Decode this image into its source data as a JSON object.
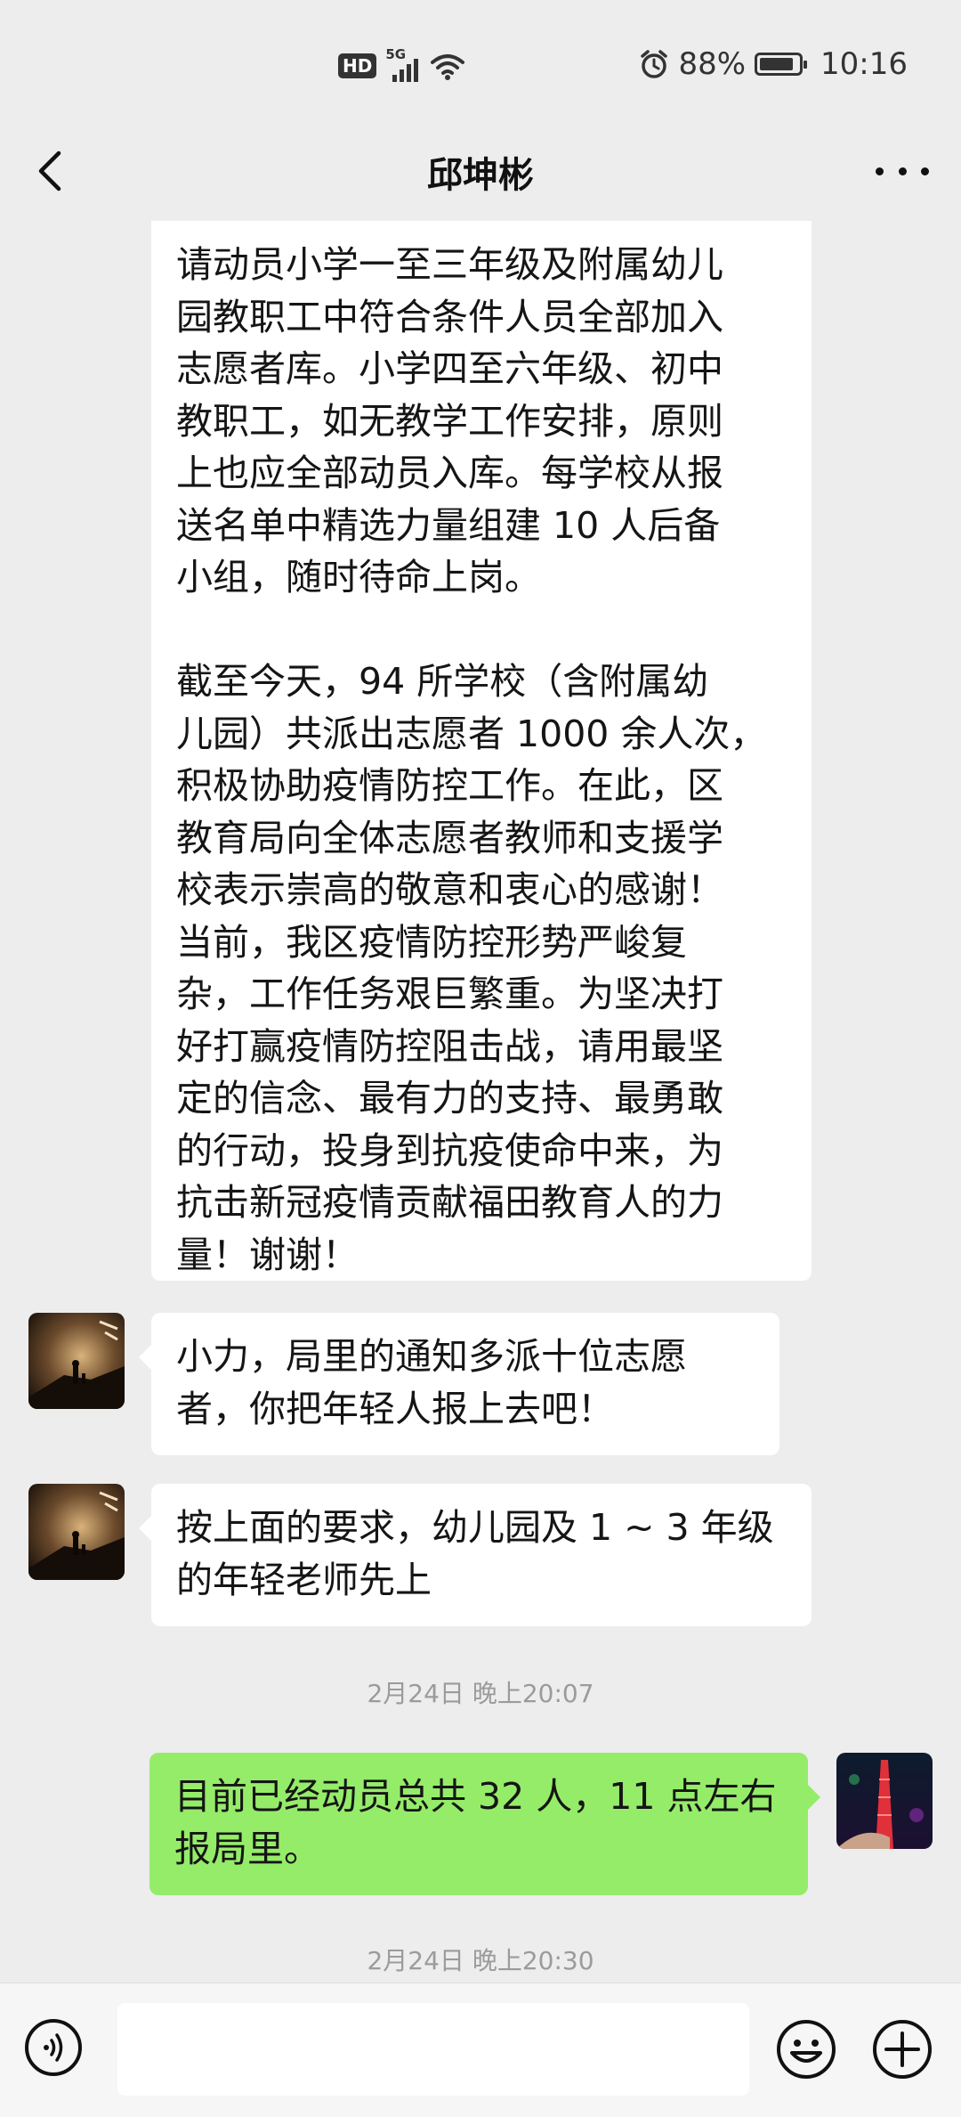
{
  "status_bar": {
    "hd": "HD",
    "network": "5G",
    "battery_percent": "88%",
    "battery_level": 0.88,
    "time": "10:16"
  },
  "header": {
    "title": "邱坤彬"
  },
  "messages": [
    {
      "side": "left",
      "text": "请动员小学一至三年级及附属幼儿\n园教职工中符合条件人员全部加入\n志愿者库。小学四至六年级、初中\n教职工，如无教学工作安排，原则\n上也应全部动员入库。每学校从报\n送名单中精选力量组建 10 人后备\n小组，随时待命上岗。\n\n截至今天，94 所学校（含附属幼\n儿园）共派出志愿者 1000 余人次，\n积极协助疫情防控工作。在此，区\n教育局向全体志愿者教师和支援学\n校表示崇高的敬意和衷心的感谢！\n当前，我区疫情防控形势严峻复\n杂，工作任务艰巨繁重。为坚决打\n好打赢疫情防控阻击战，请用最坚\n定的信念、最有力的支持、最勇敢\n的行动，投身到抗疫使命中来，为\n抗击新冠疫情贡献福田教育人的力\n量！谢谢！"
    },
    {
      "side": "left",
      "text": "小力，局里的通知多派十位志愿者，你把年轻人报上去吧！"
    },
    {
      "side": "left",
      "text": "按上面的要求，幼儿园及 1 ~ 3 年级的年轻老师先上"
    },
    {
      "side": "right",
      "text": "目前已经动员总共 32 人，11 点左右报局里。"
    }
  ],
  "timestamps": [
    "2月24日 晚上20:07",
    "2月24日 晚上20:30"
  ],
  "icons": {
    "back": "chevron-left-icon",
    "more": "more-dots-icon",
    "voice": "voice-icon",
    "emoji": "emoji-icon",
    "plus": "plus-icon"
  },
  "colors": {
    "background": "#ededed",
    "bubble_incoming": "#ffffff",
    "bubble_outgoing": "#95ec69"
  },
  "input": {
    "value": ""
  }
}
